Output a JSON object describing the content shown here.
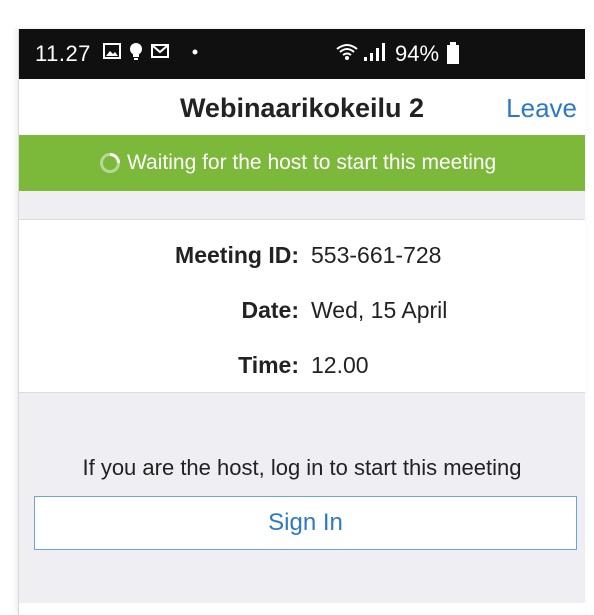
{
  "status_bar": {
    "time": "11.27",
    "notification_icons": [
      "image-icon",
      "lightbulb-icon",
      "mail-icon",
      "dot-icon"
    ],
    "connectivity_icons": [
      "wifi-icon",
      "signal-icon"
    ],
    "battery_percent": "94%"
  },
  "header": {
    "title": "Webinaarikokeilu 2",
    "leave_label": "Leave"
  },
  "banner": {
    "text": "Waiting for the host to start this meeting",
    "color": "#7cb83a"
  },
  "details": {
    "meeting_id_label": "Meeting ID:",
    "meeting_id_value": "553-661-728",
    "date_label": "Date:",
    "date_value": "Wed, 15 April",
    "time_label": "Time:",
    "time_value": "12.00"
  },
  "host": {
    "prompt": "If you are the host, log in to start this meeting",
    "sign_in_label": "Sign In"
  },
  "colors": {
    "accent": "#2d79c7",
    "status_bar": "#101010",
    "background_gray": "#efeff3"
  }
}
